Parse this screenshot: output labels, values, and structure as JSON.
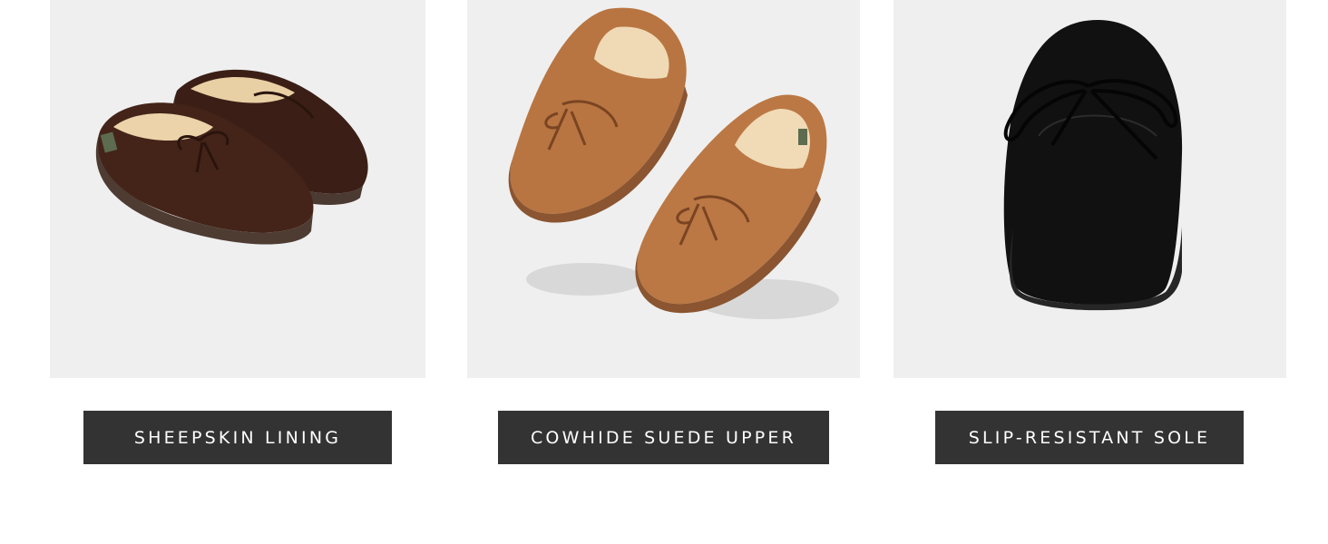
{
  "features": [
    {
      "label": "SHEEPSKIN LINING",
      "image": "brown-moccasin-pair",
      "shoe_color": "#3f2218"
    },
    {
      "label": "COWHIDE SUEDE UPPER",
      "image": "tan-moccasin-pair-floating",
      "shoe_color": "#b8733f"
    },
    {
      "label": "SLIP-RESISTANT SOLE",
      "image": "black-moccasin-single",
      "shoe_color": "#111111"
    }
  ],
  "colors": {
    "panel_background": "#efefef",
    "label_background": "#333333",
    "label_text": "#ffffff"
  }
}
